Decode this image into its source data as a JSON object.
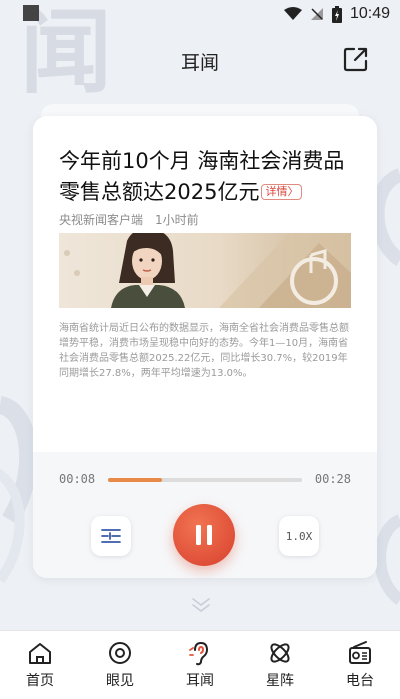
{
  "status_bar": {
    "time": "10:49",
    "icons": [
      "wifi-icon",
      "signal-icon",
      "battery-icon"
    ]
  },
  "background": {
    "watermark_char": "闻"
  },
  "header": {
    "title": "耳闻",
    "share_icon": "share-icon"
  },
  "article": {
    "title": "今年前10个月 海南社会消费品零售总额达2025亿元",
    "detail_tag": "详情",
    "source": "央视新闻客户端",
    "time_ago": "1小时前",
    "body": "海南省统计局近日公布的数据显示，海南全省社会消费品零售总额增势平稳，消费市场呈现稳中向好的态势。今年1—10月，海南省社会消费品零售总额2025.22亿元，同比增长30.7%，较2019年同期增长27.8%，两年平均增速为13.0%。"
  },
  "player": {
    "current_time": "00:08",
    "total_time": "00:28",
    "progress_percent": 28,
    "speed_label": "1.0X",
    "accent_color": "#e98948",
    "play_button_color": "#e3553d"
  },
  "tabbar": {
    "items": [
      {
        "label": "首页",
        "icon": "home-icon",
        "active": false
      },
      {
        "label": "眼见",
        "icon": "eye-icon",
        "active": false
      },
      {
        "label": "耳闻",
        "icon": "ear-icon",
        "active": true
      },
      {
        "label": "星阵",
        "icon": "star-formation-icon",
        "active": false
      },
      {
        "label": "电台",
        "icon": "radio-icon",
        "active": false
      }
    ]
  }
}
